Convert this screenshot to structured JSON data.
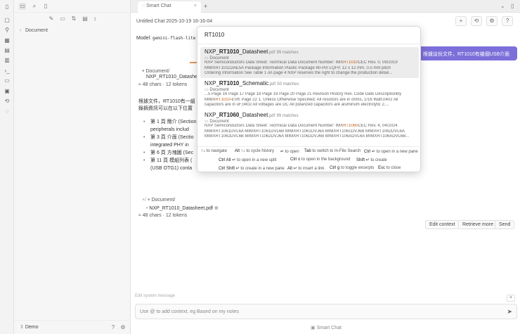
{
  "ribbon": {
    "icons": [
      "sidebar-toggle-icon",
      "files-icon",
      "graph-icon",
      "grid-icon",
      "calendar-icon",
      "template-icon",
      "pages-icon",
      "terminal-icon",
      "notes-icon",
      "chat-icon",
      "history-icon",
      "publish-icon"
    ]
  },
  "sidebar": {
    "folder": "Document",
    "vault_name": "Demo"
  },
  "tab": {
    "title": "Smart Chat"
  },
  "chat": {
    "title": "Untitled Chat 2025-10-19 16-16-04",
    "model_label": "Model:",
    "model_name": "gemini-flash-lite",
    "user_message": "根據這份文件，RT1010有幾個USB介面",
    "context1_folder": "Document/",
    "context1_file": "NXP_RT1010_Datasheet",
    "context1_tokens": "≈ 48 chars · 12 tokens",
    "response_intro": "根據文件，RT1010有一組",
    "response_intro2": "錄摘資訊可以在以下位置",
    "response_items": [
      "第 1 頁 簡介 (Section",
      "peripherals includ",
      "第 3 頁 介面 (Sectio",
      "integrated PHY in",
      "第 6 頁 方塊圖 (Sec",
      "第 11 頁 模組列表 (",
      "(USB OTG1) conta"
    ],
    "context2_folder": "Document/",
    "context2_file": "NXP_RT1010_Datasheet.pdf",
    "context2_tokens": "≈ 48 chars · 12 tokens",
    "buttons": {
      "edit": "Edit context",
      "retrieve": "Retrieve more",
      "send": "Send"
    },
    "system_placeholder": "Edit system message",
    "composer_placeholder": "Use @ to add context, eg Based on my notes",
    "footer": "Smart Chat"
  },
  "search": {
    "query": "RT1010",
    "results": [
      {
        "title_pre": "NXP_",
        "title_hl": "RT1010",
        "title_post": "_Datasheet",
        "ext": ".pdf",
        "matches": "99 matches",
        "folder": "Document",
        "snippet1_pre": "NXP Semiconductors Data Sheet: Technical Data Document Number: IMX",
        "snippet1_hl": "RT1010",
        "snippet1_post": "CEC Rev. 0, 09/2019",
        "snippet2": "MIMXRT1011DAE5A Package Information Plastic Package 80-Pin LQFP, 12 x 12 mm, 0.5 mm pitch",
        "snippet3": "Ordering Information See Table 1 on page 4 NXP reserves the right to change the production detail..."
      },
      {
        "title_pre": "NXP_",
        "title_hl": "RT1010",
        "title_post": "_Schematic",
        "ext": ".pdf",
        "matches": "50 matches",
        "folder": "Document",
        "snippet1_pre": "...5 Page 16 Page 17 Page 18 Page 19 Page 20 Page 21 Revision History Rev. Code Date DescriptionBy",
        "snippet1_hl": "",
        "snippet1_post": "",
        "snippet2_pre": "MIMX",
        "snippet2_hl": "RT1010",
        "snippet2_post": "-EVK Page 22 1. Unless Otherwise Specified: All resistors are in ohms, 1/16 Watt,0402 All",
        "snippet3": "capacitors are in uF,0402 All voltages are DC All polarized capacitors are aluminum electrolytic 2...."
      },
      {
        "title_pre": "NXP_",
        "title_hl": "RT1060",
        "title_post": "_Datasheet",
        "ext": ".pdf",
        "matches": "99 matches",
        "folder": "Document",
        "snippet1_pre": "NXP Semiconductors Data Sheet: Technical Data Document Number: IMX",
        "snippet1_hl": "RT1060",
        "snippet1_post": "CEC Rev. 4, 04/2024",
        "snippet2": "MIMXRT1061DVL6A MIMXRT1061DVL6B MIMXRT1061DVJ6A MIMXRT1061DVJ6B MIMXRT1062DVL6A",
        "snippet3": "MIMXRT1062DVL6B MIMXRT1062DVJ6A MIMXRT1062DVJ6B MIMXRT106ADVL6A MIMXRT106ADVL6B..."
      }
    ],
    "hints_row1": [
      {
        "key": "↑↓",
        "desc": "to navigate"
      },
      {
        "key": "Alt ↑↓",
        "desc": "to cycle history"
      },
      {
        "key": "↵",
        "desc": "to open"
      },
      {
        "key": "Tab",
        "desc": "to switch to In-File Search"
      },
      {
        "key": "Ctrl ↵",
        "desc": "to open in a new pane"
      }
    ],
    "hints_row2": [
      {
        "key": "Ctrl Alt ↵",
        "desc": "to open in a new split"
      },
      {
        "key": "Ctrl o",
        "desc": "to open in the background"
      },
      {
        "key": "Shift ↵",
        "desc": "to create"
      }
    ],
    "hints_row3": [
      {
        "key": "Ctrl Shift ↵",
        "desc": "to create in a new pane"
      },
      {
        "key": "Alt ↵",
        "desc": "to insert a link"
      },
      {
        "key": "Ctrl g",
        "desc": "to toggle excerpts"
      },
      {
        "key": "Esc",
        "desc": "to close"
      }
    ]
  },
  "colors": {
    "accent": "#7c6fd9",
    "highlight": "#c25f1a",
    "arrow": "#e07a2a"
  }
}
